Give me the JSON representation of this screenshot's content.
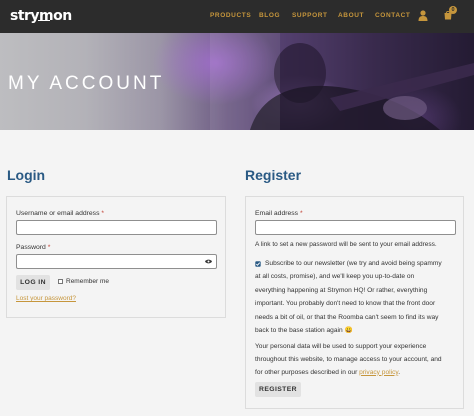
{
  "header": {
    "logo_text": "strymon",
    "nav": [
      "PRODUCTS",
      "BLOG",
      "SUPPORT",
      "ABOUT",
      "CONTACT"
    ],
    "cart_count": "0",
    "icons": [
      "user-icon",
      "cart-icon"
    ]
  },
  "hero": {
    "title": "MY ACCOUNT"
  },
  "login": {
    "title": "Login",
    "username_label": "Username or email address",
    "required_mark": "*",
    "username_value": "",
    "password_label": "Password",
    "password_value": "",
    "login_button": "LOG IN",
    "remember_me": "Remember me",
    "remember_checked": false,
    "lost_password": "Lost your password?"
  },
  "register": {
    "title": "Register",
    "email_label": "Email address",
    "email_value": "",
    "password_note": "A link to set a new password will be sent to your email address.",
    "newsletter_checked": true,
    "newsletter_lines": [
      "Subscribe to our newsletter (we try and avoid being spammy",
      "at all costs, promise), and we'll keep you up-to-date on",
      "everything happening at Strymon HQ! Or rather, everything",
      "important. You probably don't need to know that the front door",
      "needs a bit of oil, or that the Roomba can't seem to find its way",
      "back to the base station again 😀"
    ],
    "privacy_lines": [
      "Your personal data will be used to support your experience",
      "throughout this website, to manage access to your account, and"
    ],
    "privacy_prefix": "for other purposes described in our ",
    "privacy_link": "privacy policy",
    "privacy_suffix": ".",
    "register_button": "REGISTER"
  },
  "colors": {
    "accent": "#c6963c",
    "heading": "#2a5a84",
    "navbar": "#2c2c2c",
    "required": "#c0392b"
  }
}
